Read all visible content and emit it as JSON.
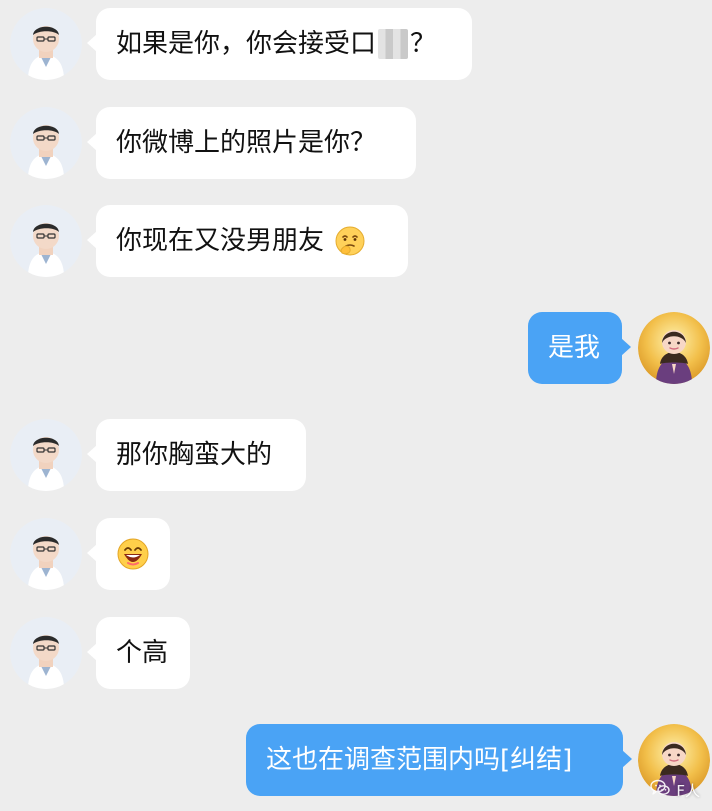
{
  "conversation": {
    "messages": [
      {
        "from": "other",
        "text_before": "如果是你，你会接受口",
        "censored": true,
        "text_after": "？"
      },
      {
        "from": "other",
        "text": "你微博上的照片是你？"
      },
      {
        "from": "other",
        "text": "你现在又没男朋友",
        "emoji": "thinking-face-emoji"
      },
      {
        "from": "me",
        "text": "是我"
      },
      {
        "from": "other",
        "text": "那你胸蛮大的"
      },
      {
        "from": "other",
        "emoji": "laughing-face-emoji"
      },
      {
        "from": "other",
        "text": "个高"
      },
      {
        "from": "me",
        "text": "这也在调查范围内吗[纠结]"
      }
    ]
  },
  "watermark": {
    "text": "F人",
    "icon": "wechat-icon"
  }
}
